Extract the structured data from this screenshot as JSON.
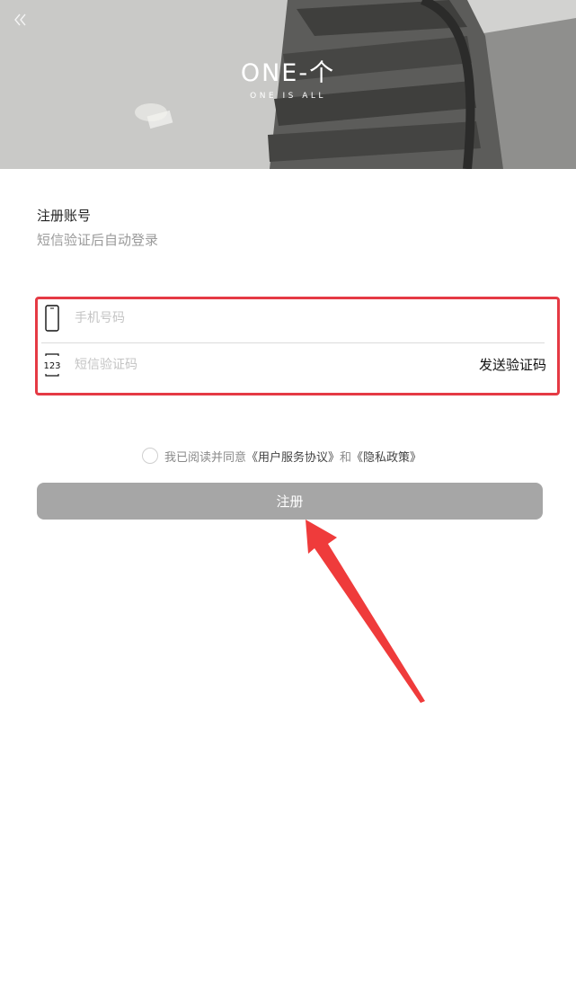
{
  "header": {
    "logo_main": "ONE-个",
    "logo_sub": "ONE IS ALL"
  },
  "register": {
    "title": "注册账号",
    "subtitle": "短信验证后自动登录",
    "phone_placeholder": "手机号码",
    "code_placeholder": "短信验证码",
    "code_icon_text": "123",
    "send_code_label": "发送验证码",
    "agree_prefix": "我已阅读并同意",
    "user_agreement": "《用户服务协议》",
    "and": "和",
    "privacy_policy": "《隐私政策》",
    "submit_label": "注册"
  },
  "colors": {
    "highlight_border": "#e53a44",
    "submit_bg": "#a6a6a6",
    "annotation_arrow": "#ef3b3b"
  },
  "icons": {
    "back": "double-chevron-left-icon",
    "phone": "phone-icon",
    "code": "sms-code-icon",
    "annotation": "arrow-pointer-icon"
  }
}
